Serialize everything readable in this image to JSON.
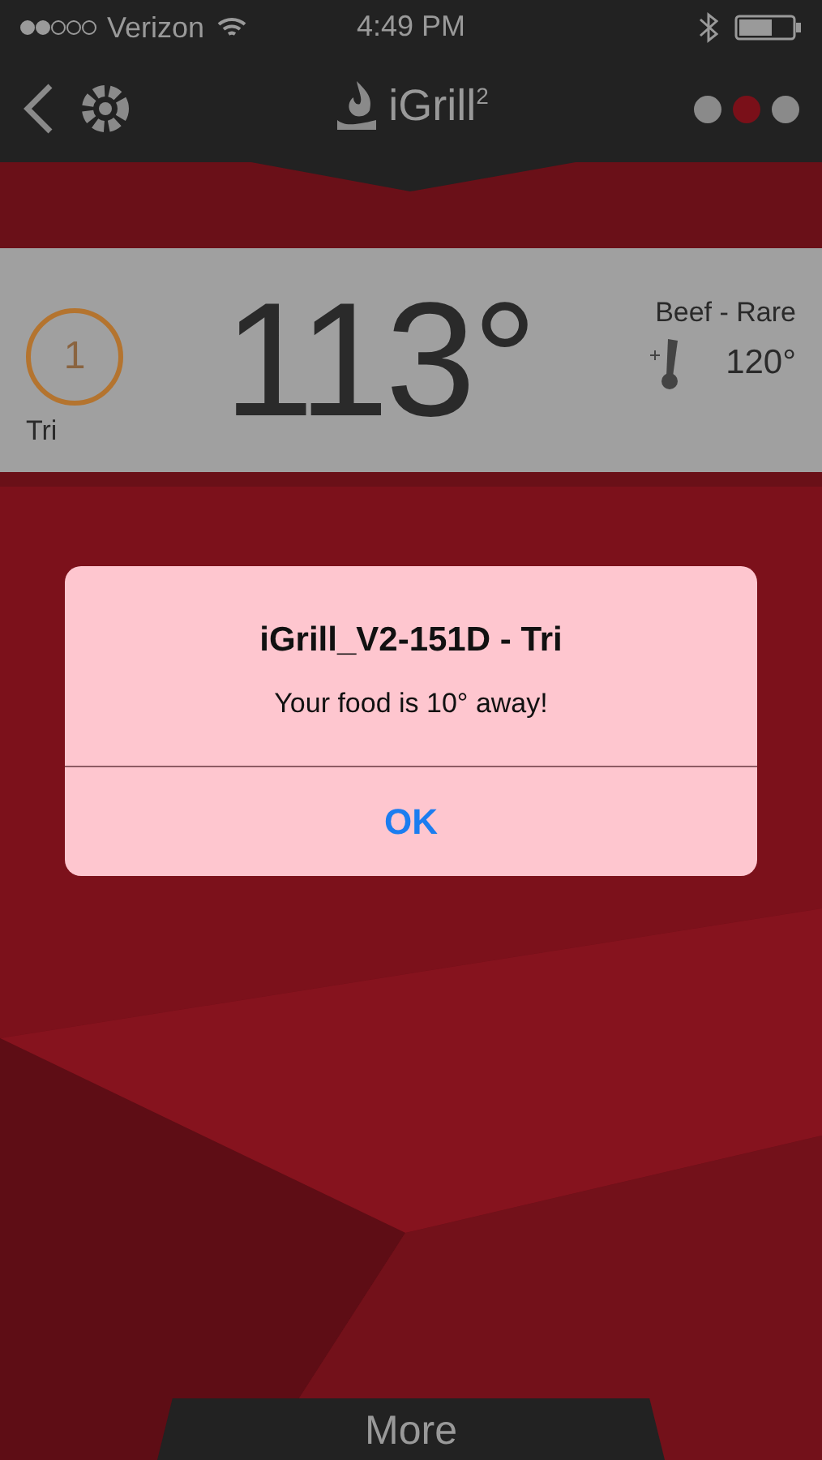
{
  "status_bar": {
    "carrier": "Verizon",
    "time": "4:49 PM"
  },
  "header": {
    "logo": "iGrill",
    "logo_sup": "2",
    "pages": [
      {
        "selected": false
      },
      {
        "selected": true
      },
      {
        "selected": false
      }
    ]
  },
  "probe": {
    "number": "1",
    "name": "Tri",
    "temperature": "113°",
    "preset": "Beef - Rare",
    "target": "120°"
  },
  "alert": {
    "title": "iGrill_V2-151D - Tri",
    "message": "Your food is 10° away!",
    "button": "OK"
  },
  "bottom_tab": {
    "label": "More"
  }
}
